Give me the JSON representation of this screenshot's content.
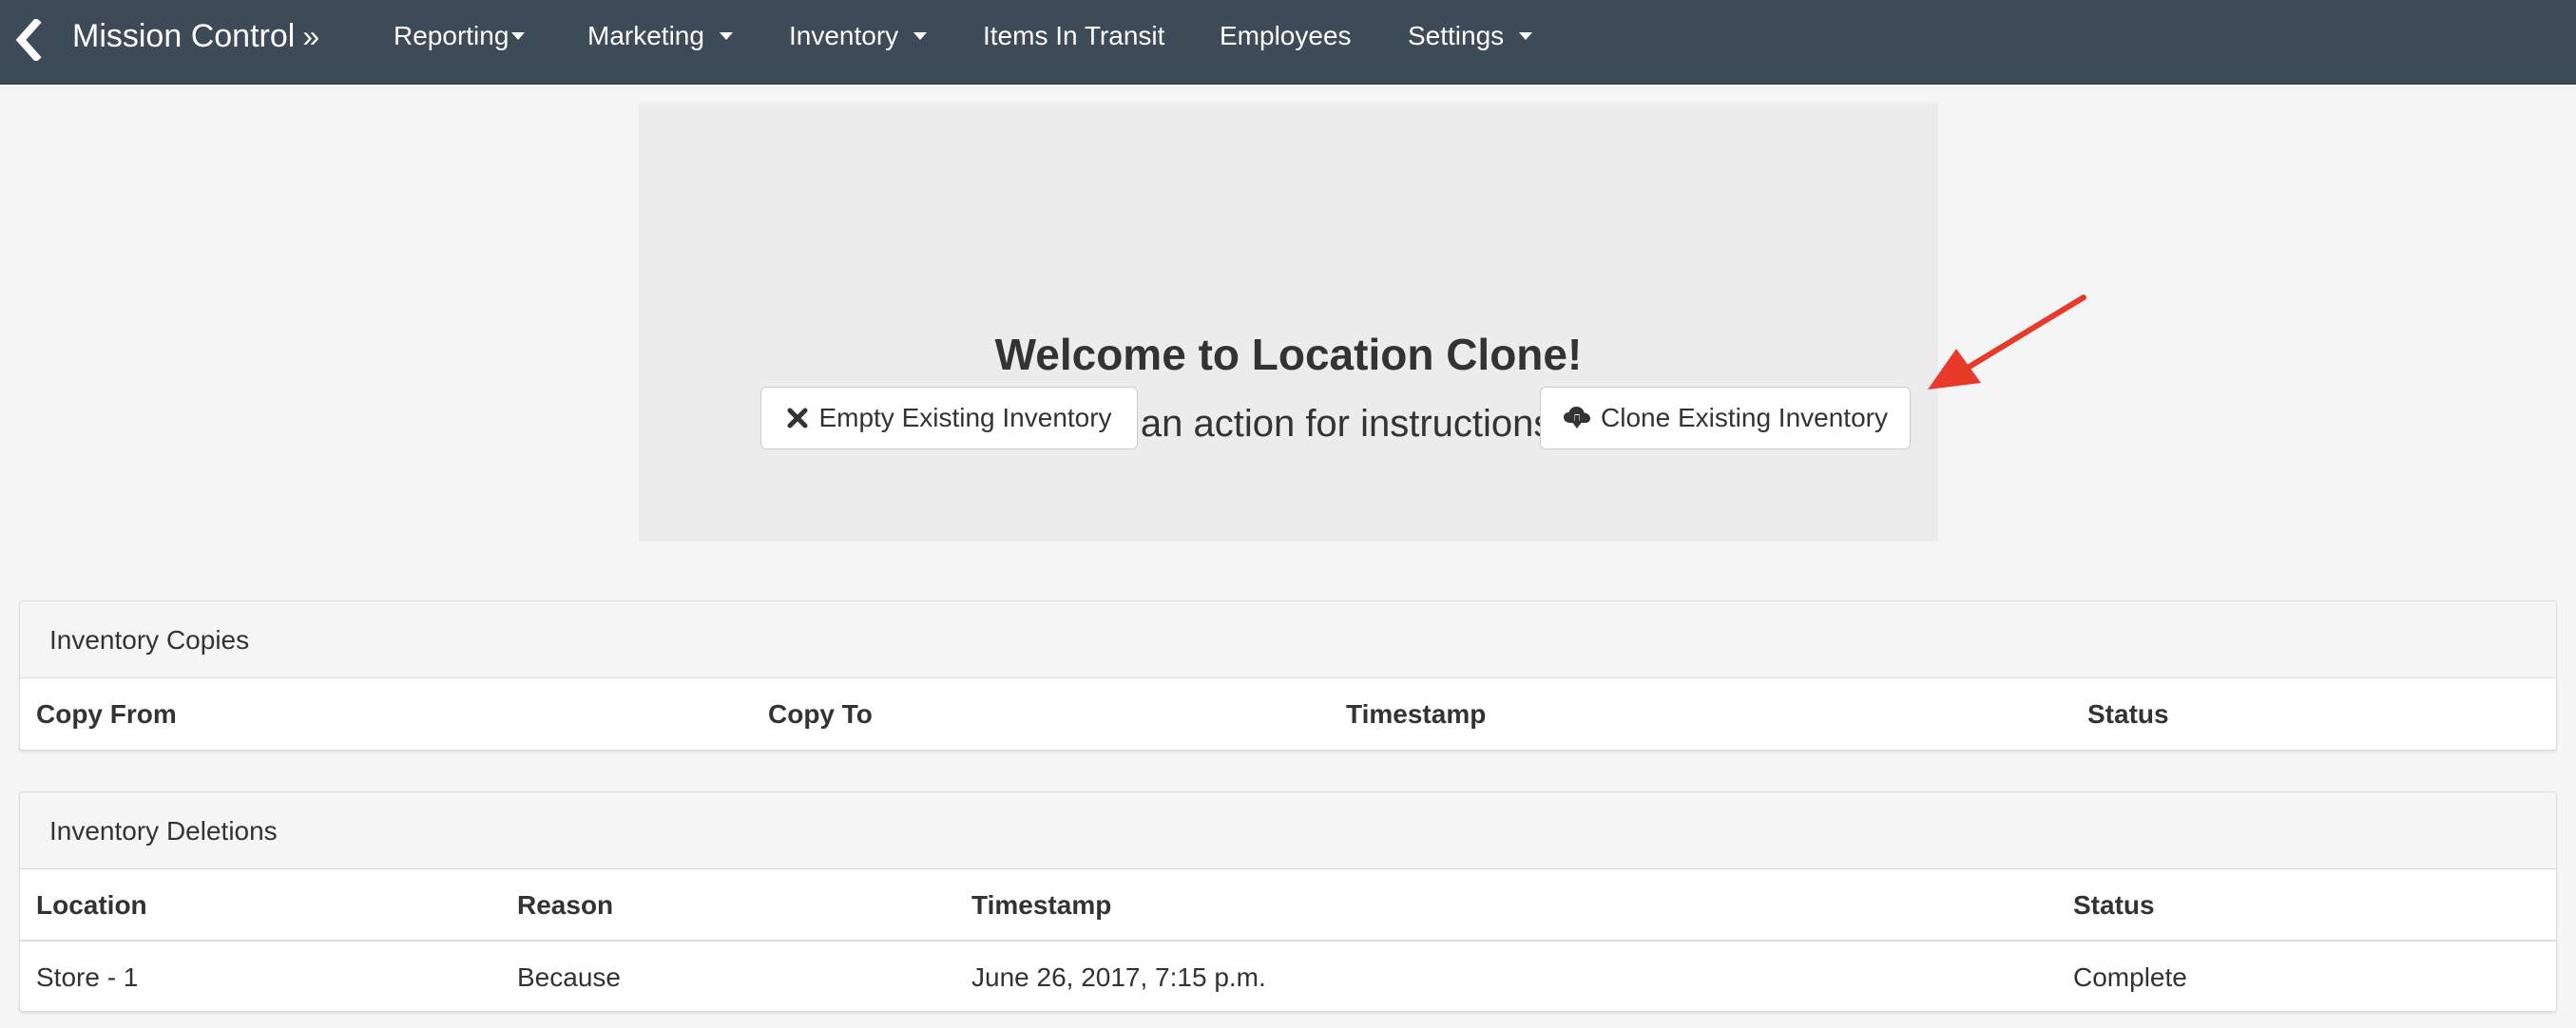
{
  "navbar": {
    "back_icon": "chevron-left-icon",
    "brand": "Mission Control",
    "brand_suffix": "»",
    "items": [
      {
        "label": "Reporting",
        "dropdown": true
      },
      {
        "label": "Marketing",
        "dropdown": true
      },
      {
        "label": "Inventory",
        "dropdown": true
      },
      {
        "label": "Items In Transit",
        "dropdown": false
      },
      {
        "label": "Employees",
        "dropdown": false
      },
      {
        "label": "Settings",
        "dropdown": true
      }
    ],
    "background_color": "#3d4a58"
  },
  "jumbotron": {
    "title": "Welcome to Location Clone!",
    "subtitle": "Select an action for instructions",
    "buttons": {
      "empty": {
        "label": "Empty Existing Inventory",
        "icon": "close-icon"
      },
      "clone": {
        "label": "Clone Existing Inventory",
        "icon": "cloud-download-icon"
      }
    },
    "annotation_arrow_color": "#e8392a"
  },
  "inventory_copies": {
    "title": "Inventory Copies",
    "columns": [
      "Copy From",
      "Copy To",
      "Timestamp",
      "Status"
    ],
    "rows": []
  },
  "inventory_deletions": {
    "title": "Inventory Deletions",
    "columns": [
      "Location",
      "Reason",
      "Timestamp",
      "Status"
    ],
    "rows": [
      [
        "Store - 1",
        "Because",
        "June 26, 2017, 7:15 p.m.",
        "Complete"
      ]
    ]
  }
}
